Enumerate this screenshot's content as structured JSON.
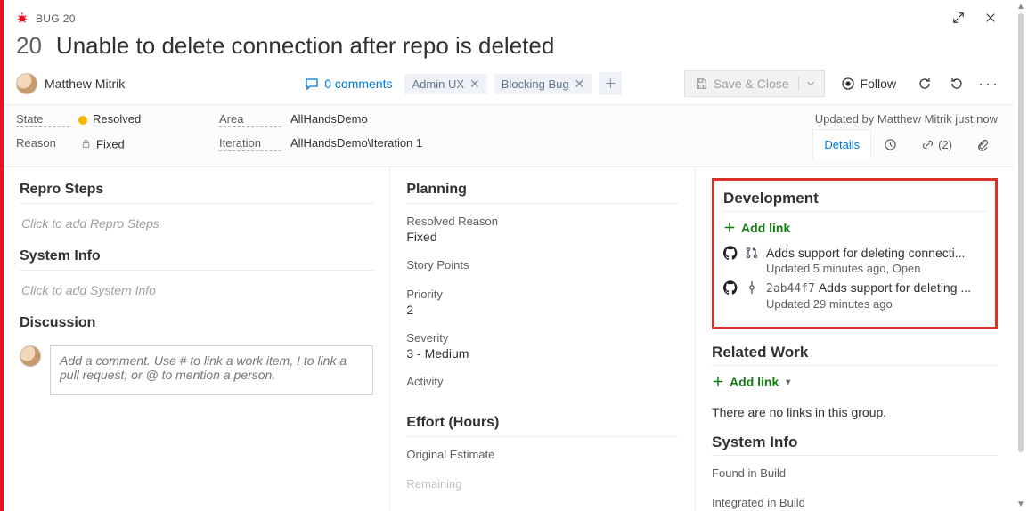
{
  "colors": {
    "accent": "#0078d4",
    "danger": "#e81123",
    "green": "#107c10"
  },
  "type": "BUG",
  "id": "20",
  "title": "Unable to delete connection after repo is deleted",
  "assignee": "Matthew Mitrik",
  "comments": {
    "label": "0 comments"
  },
  "tags": [
    {
      "label": "Admin UX"
    },
    {
      "label": "Blocking Bug"
    }
  ],
  "actions": {
    "save": "Save & Close",
    "follow": "Follow"
  },
  "meta": {
    "stateLabel": "State",
    "state": "Resolved",
    "reasonLabel": "Reason",
    "reason": "Fixed",
    "areaLabel": "Area",
    "area": "AllHandsDemo",
    "iterationLabel": "Iteration",
    "iteration": "AllHandsDemo\\Iteration 1",
    "updated": "Updated by Matthew Mitrik just now"
  },
  "tabs": {
    "details": "Details",
    "linksCount": "(2)"
  },
  "sections": {
    "repro": "Repro Steps",
    "reproPh": "Click to add Repro Steps",
    "sysinfo": "System Info",
    "sysinfoPh": "Click to add System Info",
    "discussion": "Discussion",
    "discussionPh": "Add a comment. Use # to link a work item, ! to link a pull request, or @ to mention a person.",
    "planning": "Planning",
    "effort": "Effort (Hours)"
  },
  "planning": {
    "resolvedReasonLbl": "Resolved Reason",
    "resolvedReason": "Fixed",
    "storyPointsLbl": "Story Points",
    "storyPoints": "",
    "priorityLbl": "Priority",
    "priority": "2",
    "severityLbl": "Severity",
    "severity": "3 - Medium",
    "activityLbl": "Activity",
    "activity": ""
  },
  "effort": {
    "origLbl": "Original Estimate",
    "orig": "",
    "remLbl": "Remaining",
    "rem": ""
  },
  "dev": {
    "heading": "Development",
    "addLink": "Add link",
    "items": [
      {
        "kind": "pr",
        "title": "Adds support for deleting connecti...",
        "sub": "Updated 5 minutes ago,  Open"
      },
      {
        "kind": "commit",
        "sha": "2ab44f7",
        "title": "Adds support for deleting ...",
        "sub": "Updated 29 minutes ago"
      }
    ]
  },
  "related": {
    "heading": "Related Work",
    "addLink": "Add link",
    "empty": "There are no links in this group."
  },
  "sysInfoRight": {
    "heading": "System Info",
    "foundLbl": "Found in Build",
    "found": "",
    "integratedLbl": "Integrated in Build",
    "integrated": ""
  }
}
